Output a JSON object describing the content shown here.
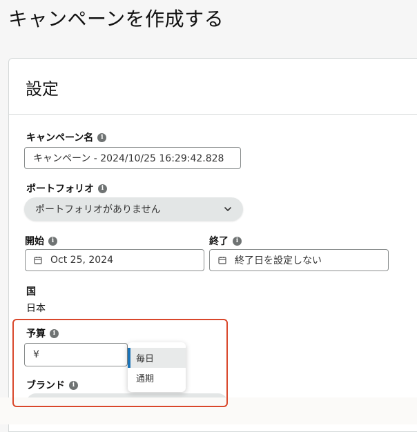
{
  "page": {
    "title": "キャンペーンを作成する"
  },
  "panel": {
    "title": "設定"
  },
  "campaign_name": {
    "label": "キャンペーン名",
    "value": "キャンペーン - 2024/10/25 16:29:42.828"
  },
  "portfolio": {
    "label": "ポートフォリオ",
    "selected": "ポートフォリオがありません"
  },
  "start": {
    "label": "開始",
    "value": "Oct 25, 2024"
  },
  "end": {
    "label": "終了",
    "value": "終了日を設定しない"
  },
  "country": {
    "label": "国",
    "value": "日本"
  },
  "budget": {
    "label": "予算",
    "currency": "¥",
    "options": [
      "毎日",
      "通期"
    ],
    "selected_option": "毎日"
  },
  "brand": {
    "label": "ブランド"
  },
  "colors": {
    "highlight": "#d9472b",
    "selected_accent": "#1a73b8",
    "pill_bg": "#e3e6e6"
  },
  "icons": {
    "info": "info-icon",
    "calendar": "calendar-icon",
    "chevron": "chevron-down-icon"
  }
}
